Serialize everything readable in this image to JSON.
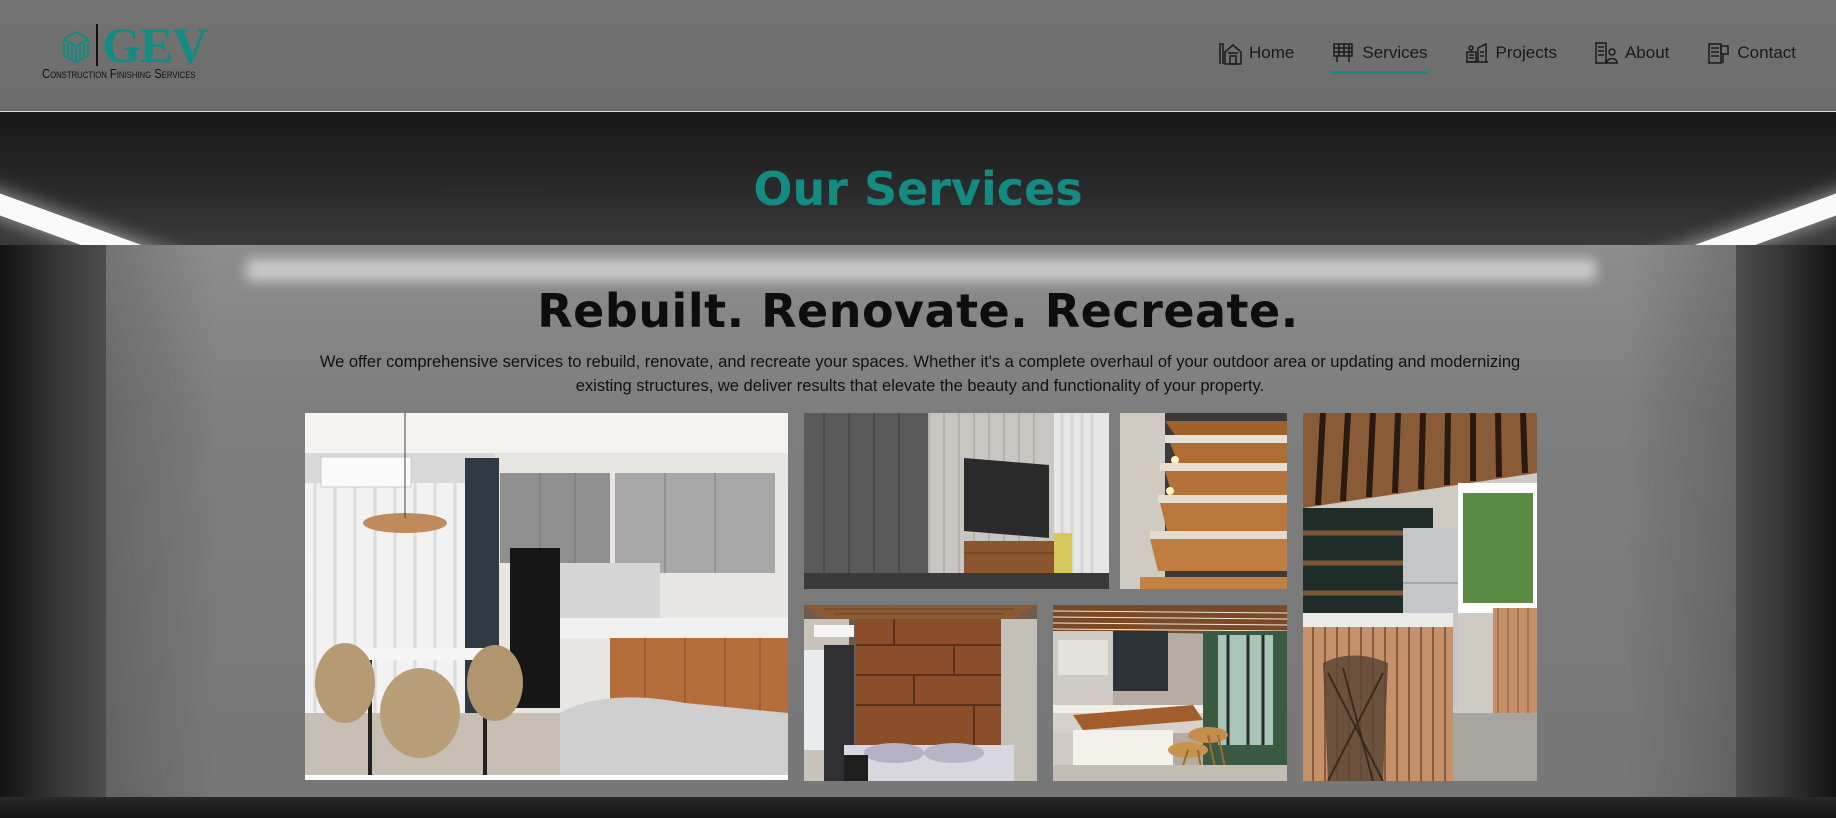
{
  "header": {
    "logo": {
      "name": "GEV",
      "tagline": "Construction Finishing Services",
      "brand_color": "#138b80"
    },
    "nav": [
      {
        "label": "Home",
        "icon": "house-icon",
        "active": false
      },
      {
        "label": "Services",
        "icon": "services-icon",
        "active": true
      },
      {
        "label": "Projects",
        "icon": "projects-icon",
        "active": false
      },
      {
        "label": "About",
        "icon": "about-icon",
        "active": false
      },
      {
        "label": "Contact",
        "icon": "contact-icon",
        "active": false
      }
    ]
  },
  "services": {
    "title": "Our Services",
    "headline": "Rebuilt. Renovate. Recreate.",
    "description": "We offer comprehensive services to rebuild, renovate, and recreate your spaces. Whether it's a complete overhaul of your outdoor area or updating and modernizing existing structures, we deliver results that elevate the beauty and functionality of your property.",
    "gallery": [
      {
        "subject": "kitchen-dining-room"
      },
      {
        "subject": "living-room-tv-wall"
      },
      {
        "subject": "lit-wooden-staircase"
      },
      {
        "subject": "kitchen-bar-counter"
      },
      {
        "subject": "bedroom-wood-panel-wall"
      },
      {
        "subject": "kitchen-island-with-stools"
      }
    ]
  },
  "colors": {
    "accent": "#138b80",
    "header_bg": "#6f6f6f",
    "panel_bg": "#7e7e7e"
  }
}
